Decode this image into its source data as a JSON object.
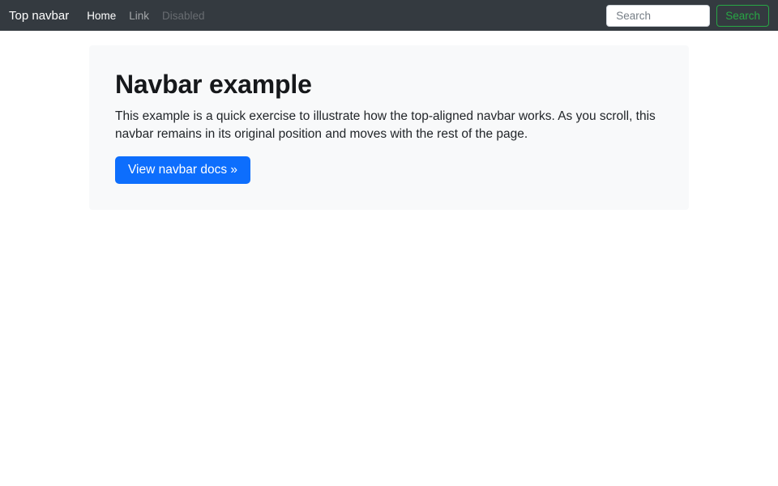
{
  "navbar": {
    "brand": "Top navbar",
    "items": [
      {
        "label": "Home",
        "state": "active"
      },
      {
        "label": "Link",
        "state": "normal"
      },
      {
        "label": "Disabled",
        "state": "disabled"
      }
    ],
    "search": {
      "placeholder": "Search",
      "button_label": "Search"
    }
  },
  "jumbotron": {
    "title": "Navbar example",
    "body": "This example is a quick exercise to illustrate how the top-aligned navbar works. As you scroll, this navbar remains in its original position and moves with the rest of the page.",
    "cta_label": "View navbar docs »"
  },
  "colors": {
    "navbar_bg": "#343a40",
    "primary_blue": "#0d6efd",
    "success_green": "#28a745",
    "jumbotron_bg": "#f8f9fa",
    "text": "#212529"
  }
}
